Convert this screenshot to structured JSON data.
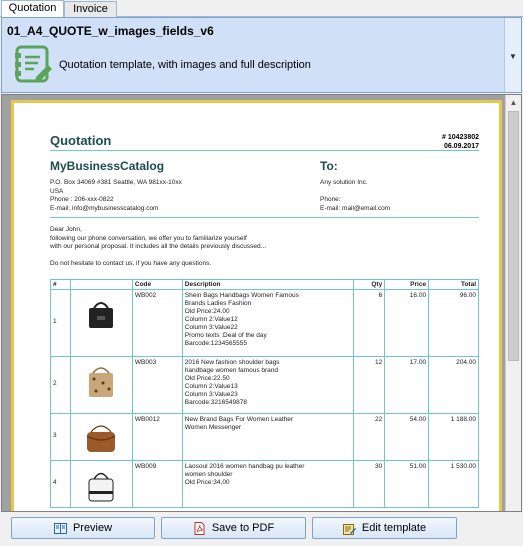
{
  "tabs": [
    {
      "label": "Quotation"
    },
    {
      "label": "Invoice"
    }
  ],
  "template": {
    "name": "01_A4_QUOTE_w_images_fields_v6",
    "description": "Quotation template, with images and full description"
  },
  "document": {
    "title": "Quotation",
    "number": "# 10423802",
    "date": "06.09.2017",
    "company": "MyBusinessCatalog",
    "company_address": "P.O. Box 34069 #381 Seattle, WA 981xx-10xx",
    "company_country": "USA",
    "company_phone": "Phone : 206-xxx-0822",
    "company_email": "E-mail: info@mybusinesscatalog.com",
    "to_label": "To:",
    "client_name": "Any solution Inc.",
    "client_phone": "Phone:",
    "client_email": "E-mail: mail@email.com",
    "greeting": "Dear John,",
    "intro_line1": "following our phone conversation, we offer you to familiarize yourself",
    "intro_line2": "with our personal proposal. It includes all the details previously discussed...",
    "closing": "Do not hesitate to contact us, if you have any questions.",
    "table_headers": {
      "num": "#",
      "code": "Code",
      "description": "Description",
      "qty": "Qty",
      "price": "Price",
      "total": "Total"
    },
    "items": [
      {
        "num": "1",
        "code": "WB002",
        "desc": [
          "Shein Bags Handbags Women Famous",
          "Brands Ladies Fashion",
          "Old Price:24.00",
          "Column 2:Value12",
          "Column 3:Value22",
          "Promo texts :Deal of the day",
          "Barcode:1234565555"
        ],
        "qty": "6",
        "price": "16.00",
        "total": "96.00"
      },
      {
        "num": "2",
        "code": "WB003",
        "desc": [
          "2016 New fashion shoulder bags",
          "handbage women famous brand",
          "Old Price:22.50",
          "Column 2:Value13",
          "Column 3:Value23",
          "Barcode:3216549878"
        ],
        "qty": "12",
        "price": "17.00",
        "total": "204.00"
      },
      {
        "num": "3",
        "code": "WB0012",
        "desc": [
          "New Brand Bags For Women Leather",
          "Women Messenger"
        ],
        "qty": "22",
        "price": "54.00",
        "total": "1 188.00"
      },
      {
        "num": "4",
        "code": "WB009",
        "desc": [
          "Laosoul 2016 women handbag pu leather",
          "women shoulder",
          "Old Price:34,00"
        ],
        "qty": "30",
        "price": "51.00",
        "total": "1 530.00"
      }
    ]
  },
  "buttons": {
    "preview": "Preview",
    "save_pdf": "Save to PDF",
    "edit_template": "Edit template"
  },
  "colors": {
    "accent": "#1d4d4d",
    "rule": "#6fc6d0",
    "page_border": "#e8c84a",
    "selector_bg": "#cfe0f7"
  },
  "icons": [
    "document-template-icon",
    "dropdown-arrow-icon",
    "preview-icon",
    "pdf-icon",
    "edit-template-icon",
    "handbag-thumbnail"
  ]
}
